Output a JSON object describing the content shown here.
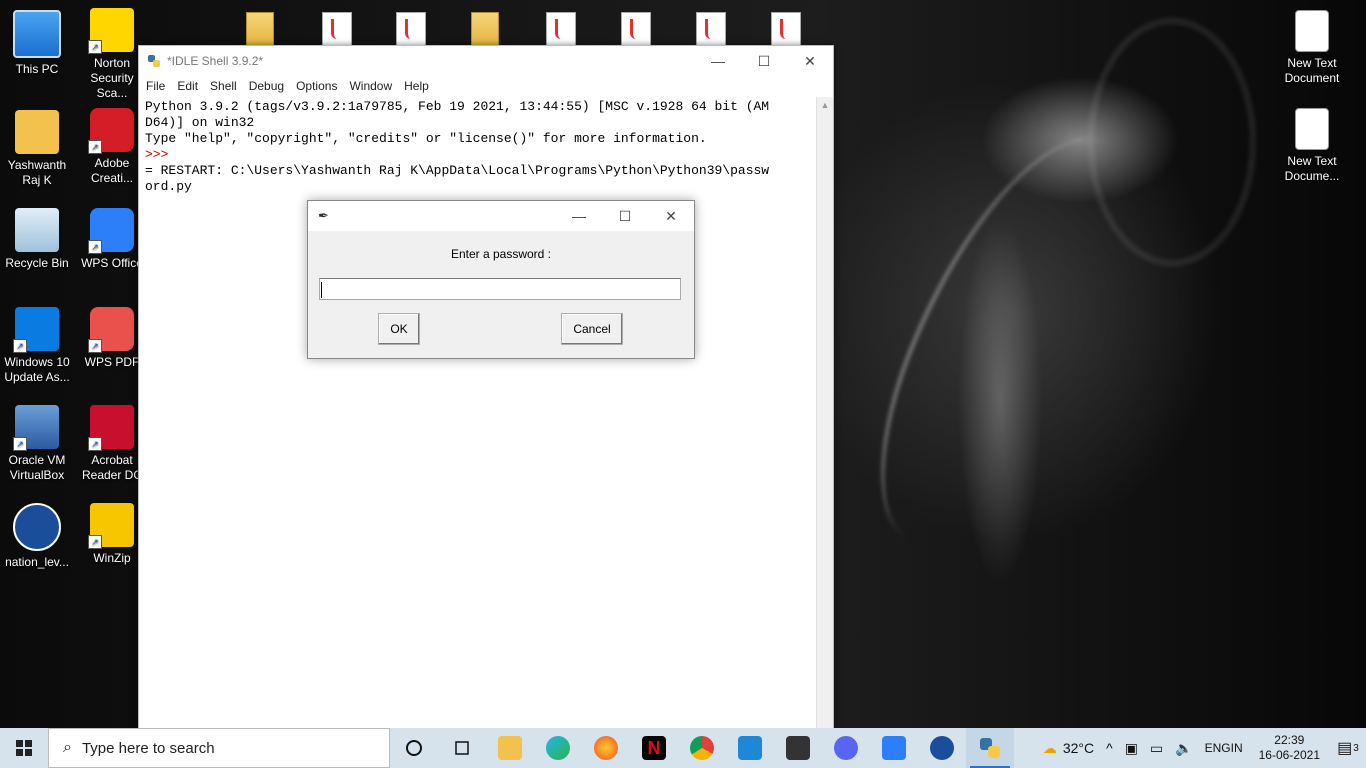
{
  "desktop": {
    "left_icons": [
      {
        "label": "This PC",
        "icon": "this-pc-icon"
      },
      {
        "label": "Norton Security Sca...",
        "icon": "norton-icon"
      },
      {
        "label": "Yashwanth Raj K",
        "icon": "user-folder-icon"
      },
      {
        "label": "Adobe Creati...",
        "icon": "adobe-cc-icon"
      },
      {
        "label": "Recycle Bin",
        "icon": "recycle-bin-icon"
      },
      {
        "label": "WPS Office",
        "icon": "wps-office-icon"
      },
      {
        "label": "Windows 10 Update As...",
        "icon": "windows-update-icon"
      },
      {
        "label": "WPS PDF",
        "icon": "wps-pdf-icon"
      },
      {
        "label": "Oracle VM VirtualBox",
        "icon": "virtualbox-icon"
      },
      {
        "label": "Acrobat Reader DC",
        "icon": "acrobat-icon"
      },
      {
        "label": "nation_lev...",
        "icon": "nation-icon"
      },
      {
        "label": "WinZip",
        "icon": "winzip-icon"
      }
    ],
    "right_icons": [
      {
        "label": "New Text Document",
        "icon": "text-document-icon"
      },
      {
        "label": "New Text Docume...",
        "icon": "text-document-icon"
      }
    ]
  },
  "idle_window": {
    "title": "*IDLE Shell 3.9.2*",
    "menu": [
      "File",
      "Edit",
      "Shell",
      "Debug",
      "Options",
      "Window",
      "Help"
    ],
    "lines": [
      "Python 3.9.2 (tags/v3.9.2:1a79785, Feb 19 2021, 13:44:55) [MSC v.1928 64 bit (AM",
      "D64)] on win32",
      "Type \"help\", \"copyright\", \"credits\" or \"license()\" for more information.",
      ">>> ",
      "= RESTART: C:\\Users\\Yashwanth Raj K\\AppData\\Local\\Programs\\Python\\Python39\\passw",
      "ord.py"
    ]
  },
  "dialog": {
    "prompt": "Enter a password :",
    "input_value": "",
    "ok_label": "OK",
    "cancel_label": "Cancel"
  },
  "taskbar": {
    "search_placeholder": "Type here to search",
    "weather": "32°C",
    "language_line1": "ENG",
    "language_line2": "IN",
    "time": "22:39",
    "date": "16-06-2021",
    "notification_count": "3"
  },
  "colors": {
    "taskbar_bg": "#d7e3ec",
    "prompt_red": "#c00000",
    "dialog_bg": "#f0f0f0"
  }
}
